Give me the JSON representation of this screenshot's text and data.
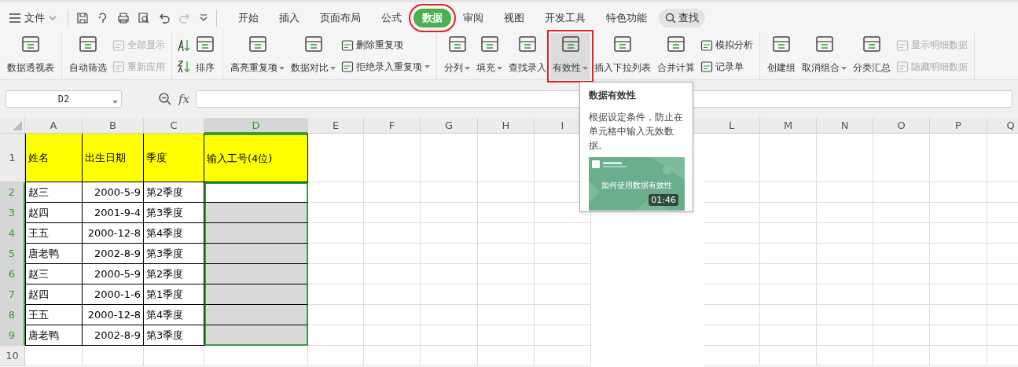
{
  "file_menu": {
    "label": "文件"
  },
  "tabs": [
    {
      "label": "开始",
      "selected": false,
      "highlighted": false
    },
    {
      "label": "插入",
      "selected": false,
      "highlighted": false
    },
    {
      "label": "页面布局",
      "selected": false,
      "highlighted": false
    },
    {
      "label": "公式",
      "selected": false,
      "highlighted": false
    },
    {
      "label": "数据",
      "selected": true,
      "highlighted": true
    },
    {
      "label": "审阅",
      "selected": false,
      "highlighted": false
    },
    {
      "label": "视图",
      "selected": false,
      "highlighted": false
    },
    {
      "label": "开发工具",
      "selected": false,
      "highlighted": false
    },
    {
      "label": "特色功能",
      "selected": false,
      "highlighted": false
    }
  ],
  "search": {
    "label": "查找"
  },
  "ribbon": [
    {
      "items": [
        {
          "kind": "large",
          "label": "数据透视表",
          "dropdown": false,
          "disabled": false,
          "highlighted": false
        }
      ]
    },
    {
      "items": [
        {
          "kind": "large",
          "label": "自动筛选",
          "dropdown": false,
          "disabled": false,
          "highlighted": false
        },
        {
          "kind": "stack",
          "rows": [
            {
              "label": "全部显示",
              "dropdown": false,
              "disabled": true
            },
            {
              "label": "重新应用",
              "dropdown": false,
              "disabled": true
            }
          ]
        }
      ]
    },
    {
      "items": [
        {
          "kind": "sort-pair"
        },
        {
          "kind": "large",
          "label": "排序",
          "dropdown": false,
          "disabled": false,
          "highlighted": false
        }
      ]
    },
    {
      "items": [
        {
          "kind": "large",
          "label": "高亮重复项",
          "dropdown": true,
          "disabled": false,
          "highlighted": false
        },
        {
          "kind": "large",
          "label": "数据对比",
          "dropdown": true,
          "disabled": false,
          "highlighted": false
        },
        {
          "kind": "stack",
          "rows": [
            {
              "label": "删除重复项",
              "dropdown": false,
              "disabled": false
            },
            {
              "label": "拒绝录入重复项",
              "dropdown": true,
              "disabled": false
            }
          ]
        }
      ]
    },
    {
      "items": [
        {
          "kind": "large",
          "label": "分列",
          "dropdown": true,
          "disabled": false,
          "highlighted": false
        },
        {
          "kind": "large",
          "label": "填充",
          "dropdown": true,
          "disabled": false,
          "highlighted": false
        },
        {
          "kind": "large",
          "label": "查找录入",
          "dropdown": false,
          "disabled": false,
          "highlighted": false
        },
        {
          "kind": "large",
          "label": "有效性",
          "dropdown": true,
          "disabled": false,
          "highlighted": true
        },
        {
          "kind": "large",
          "label": "插入下拉列表",
          "dropdown": false,
          "disabled": false,
          "highlighted": false
        },
        {
          "kind": "large",
          "label": "合并计算",
          "dropdown": false,
          "disabled": false,
          "highlighted": false
        },
        {
          "kind": "stack",
          "rows": [
            {
              "label": "模拟分析",
              "dropdown": false,
              "disabled": false
            },
            {
              "label": "记录单",
              "dropdown": false,
              "disabled": false
            }
          ]
        }
      ]
    },
    {
      "items": [
        {
          "kind": "large",
          "label": "创建组",
          "dropdown": false,
          "disabled": false,
          "highlighted": false
        },
        {
          "kind": "large",
          "label": "取消组合",
          "dropdown": true,
          "disabled": false,
          "highlighted": false
        },
        {
          "kind": "large",
          "label": "分类汇总",
          "dropdown": false,
          "disabled": false,
          "highlighted": false
        },
        {
          "kind": "stack",
          "rows": [
            {
              "label": "显示明细数据",
              "dropdown": false,
              "disabled": true
            },
            {
              "label": "隐藏明细数据",
              "dropdown": false,
              "disabled": true
            }
          ]
        }
      ]
    }
  ],
  "name_box": {
    "value": "D2"
  },
  "formula_bar": {
    "label": "fx"
  },
  "columns": [
    {
      "label": "A",
      "selected": false
    },
    {
      "label": "B",
      "selected": false
    },
    {
      "label": "C",
      "selected": false
    },
    {
      "label": "D",
      "selected": true
    },
    {
      "label": "E",
      "selected": false
    },
    {
      "label": "F",
      "selected": false
    },
    {
      "label": "G",
      "selected": false
    },
    {
      "label": "H",
      "selected": false
    },
    {
      "label": "I",
      "selected": false
    },
    {
      "label": "L",
      "selected": false,
      "after_gap": true
    },
    {
      "label": "M",
      "selected": false
    },
    {
      "label": "N",
      "selected": false
    },
    {
      "label": "O",
      "selected": false
    },
    {
      "label": "P",
      "selected": false
    },
    {
      "label": "Q",
      "selected": false
    }
  ],
  "rows": [
    {
      "number": "1",
      "selected": false,
      "kind": "header",
      "cells": [
        "姓名",
        "出生日期",
        "季度",
        "输入工号(4位)"
      ]
    },
    {
      "number": "2",
      "selected": true,
      "kind": "data",
      "cells": [
        "赵三",
        "2000-5-9",
        "第2季度"
      ]
    },
    {
      "number": "3",
      "selected": true,
      "kind": "data",
      "cells": [
        "赵四",
        "2001-9-4",
        "第3季度"
      ]
    },
    {
      "number": "4",
      "selected": true,
      "kind": "data",
      "cells": [
        "王五",
        "2000-12-8",
        "第4季度"
      ]
    },
    {
      "number": "5",
      "selected": true,
      "kind": "data",
      "cells": [
        "唐老鸭",
        "2002-8-9",
        "第3季度"
      ]
    },
    {
      "number": "6",
      "selected": true,
      "kind": "data",
      "cells": [
        "赵三",
        "2000-5-9",
        "第2季度"
      ]
    },
    {
      "number": "7",
      "selected": true,
      "kind": "data",
      "cells": [
        "赵四",
        "2000-1-6",
        "第1季度"
      ]
    },
    {
      "number": "8",
      "selected": true,
      "kind": "data",
      "cells": [
        "王五",
        "2000-12-8",
        "第4季度"
      ]
    },
    {
      "number": "9",
      "selected": true,
      "kind": "data",
      "cells": [
        "唐老鸭",
        "2002-8-9",
        "第3季度"
      ]
    },
    {
      "number": "10",
      "selected": false,
      "kind": "empty",
      "cells": []
    }
  ],
  "tooltip": {
    "title": "数据有效性",
    "body": "根据设定条件，防止在单元格中输入无效数据。",
    "video": {
      "kind": "picture",
      "caption": "如何使用数据有效性",
      "duration": "01:46"
    }
  }
}
